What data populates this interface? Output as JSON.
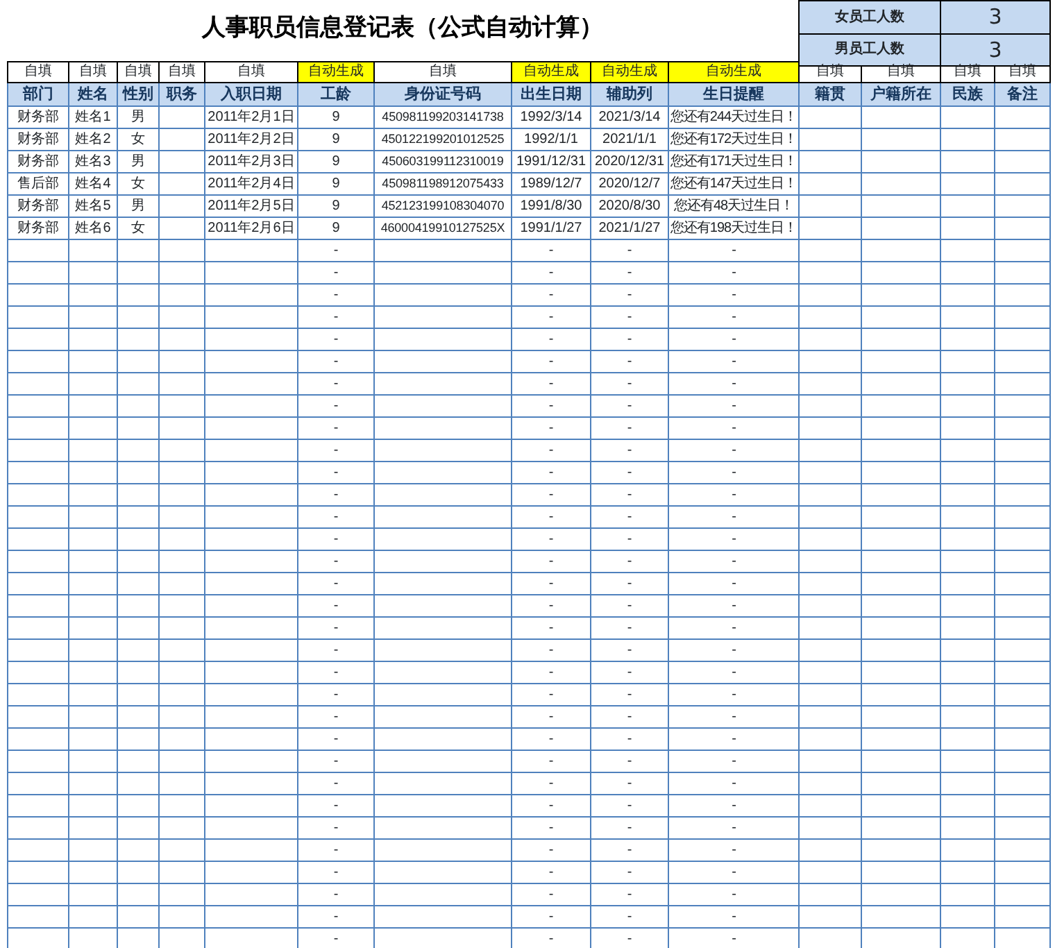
{
  "title": "人事职员信息登记表（公式自动计算）",
  "summary": [
    {
      "label": "女员工人数",
      "value": "3"
    },
    {
      "label": "男员工人数",
      "value": "3"
    }
  ],
  "columns": [
    {
      "fill": "自填",
      "kind": "manual",
      "header": "部门"
    },
    {
      "fill": "自填",
      "kind": "manual",
      "header": "姓名"
    },
    {
      "fill": "自填",
      "kind": "manual",
      "header": "性别"
    },
    {
      "fill": "自填",
      "kind": "manual",
      "header": "职务"
    },
    {
      "fill": "自填",
      "kind": "manual",
      "header": "入职日期"
    },
    {
      "fill": "自动生成",
      "kind": "auto",
      "header": "工龄"
    },
    {
      "fill": "自填",
      "kind": "manual",
      "header": "身份证号码"
    },
    {
      "fill": "自动生成",
      "kind": "auto",
      "header": "出生日期"
    },
    {
      "fill": "自动生成",
      "kind": "auto",
      "header": "辅助列"
    },
    {
      "fill": "自动生成",
      "kind": "auto",
      "header": "生日提醒"
    },
    {
      "fill": "自填",
      "kind": "manual",
      "header": "籍贯"
    },
    {
      "fill": "自填",
      "kind": "manual",
      "header": "户籍所在"
    },
    {
      "fill": "自填",
      "kind": "manual",
      "header": "民族"
    },
    {
      "fill": "自填",
      "kind": "manual",
      "header": "备注"
    }
  ],
  "rows": [
    [
      "财务部",
      "姓名1",
      "男",
      null,
      "2011年2月1日",
      "9",
      "450981199203141738",
      "1992/3/14",
      "2021/3/14",
      "您还有244天过生日！",
      null,
      null,
      null,
      null
    ],
    [
      "财务部",
      "姓名2",
      "女",
      null,
      "2011年2月2日",
      "9",
      "450122199201012525",
      "1992/1/1",
      "2021/1/1",
      "您还有172天过生日！",
      null,
      null,
      null,
      null
    ],
    [
      "财务部",
      "姓名3",
      "男",
      null,
      "2011年2月3日",
      "9",
      "450603199112310019",
      "1991/12/31",
      "2020/12/31",
      "您还有171天过生日！",
      null,
      null,
      null,
      null
    ],
    [
      "售后部",
      "姓名4",
      "女",
      null,
      "2011年2月4日",
      "9",
      "450981198912075433",
      "1989/12/7",
      "2020/12/7",
      "您还有147天过生日！",
      null,
      null,
      null,
      null
    ],
    [
      "财务部",
      "姓名5",
      "男",
      null,
      "2011年2月5日",
      "9",
      "452123199108304070",
      "1991/8/30",
      "2020/8/30",
      "您还有48天过生日！",
      null,
      null,
      null,
      null
    ],
    [
      "财务部",
      "姓名6",
      "女",
      null,
      "2011年2月6日",
      "9",
      "46000419910127525X",
      "1991/1/27",
      "2021/1/27",
      "您还有198天过生日！",
      null,
      null,
      null,
      null
    ],
    [
      null,
      null,
      null,
      null,
      null,
      "-",
      null,
      "-",
      "-",
      "-",
      null,
      null,
      null,
      null
    ],
    [
      null,
      null,
      null,
      null,
      null,
      "-",
      null,
      "-",
      "-",
      "-",
      null,
      null,
      null,
      null
    ],
    [
      null,
      null,
      null,
      null,
      null,
      "-",
      null,
      "-",
      "-",
      "-",
      null,
      null,
      null,
      null
    ],
    [
      null,
      null,
      null,
      null,
      null,
      "-",
      null,
      "-",
      "-",
      "-",
      null,
      null,
      null,
      null
    ],
    [
      null,
      null,
      null,
      null,
      null,
      "-",
      null,
      "-",
      "-",
      "-",
      null,
      null,
      null,
      null
    ],
    [
      null,
      null,
      null,
      null,
      null,
      "-",
      null,
      "-",
      "-",
      "-",
      null,
      null,
      null,
      null
    ],
    [
      null,
      null,
      null,
      null,
      null,
      "-",
      null,
      "-",
      "-",
      "-",
      null,
      null,
      null,
      null
    ],
    [
      null,
      null,
      null,
      null,
      null,
      "-",
      null,
      "-",
      "-",
      "-",
      null,
      null,
      null,
      null
    ],
    [
      null,
      null,
      null,
      null,
      null,
      "-",
      null,
      "-",
      "-",
      "-",
      null,
      null,
      null,
      null
    ],
    [
      null,
      null,
      null,
      null,
      null,
      "-",
      null,
      "-",
      "-",
      "-",
      null,
      null,
      null,
      null
    ],
    [
      null,
      null,
      null,
      null,
      null,
      "-",
      null,
      "-",
      "-",
      "-",
      null,
      null,
      null,
      null
    ],
    [
      null,
      null,
      null,
      null,
      null,
      "-",
      null,
      "-",
      "-",
      "-",
      null,
      null,
      null,
      null
    ],
    [
      null,
      null,
      null,
      null,
      null,
      "-",
      null,
      "-",
      "-",
      "-",
      null,
      null,
      null,
      null
    ],
    [
      null,
      null,
      null,
      null,
      null,
      "-",
      null,
      "-",
      "-",
      "-",
      null,
      null,
      null,
      null
    ],
    [
      null,
      null,
      null,
      null,
      null,
      "-",
      null,
      "-",
      "-",
      "-",
      null,
      null,
      null,
      null
    ],
    [
      null,
      null,
      null,
      null,
      null,
      "-",
      null,
      "-",
      "-",
      "-",
      null,
      null,
      null,
      null
    ],
    [
      null,
      null,
      null,
      null,
      null,
      "-",
      null,
      "-",
      "-",
      "-",
      null,
      null,
      null,
      null
    ],
    [
      null,
      null,
      null,
      null,
      null,
      "-",
      null,
      "-",
      "-",
      "-",
      null,
      null,
      null,
      null
    ],
    [
      null,
      null,
      null,
      null,
      null,
      "-",
      null,
      "-",
      "-",
      "-",
      null,
      null,
      null,
      null
    ],
    [
      null,
      null,
      null,
      null,
      null,
      "-",
      null,
      "-",
      "-",
      "-",
      null,
      null,
      null,
      null
    ],
    [
      null,
      null,
      null,
      null,
      null,
      "-",
      null,
      "-",
      "-",
      "-",
      null,
      null,
      null,
      null
    ],
    [
      null,
      null,
      null,
      null,
      null,
      "-",
      null,
      "-",
      "-",
      "-",
      null,
      null,
      null,
      null
    ],
    [
      null,
      null,
      null,
      null,
      null,
      "-",
      null,
      "-",
      "-",
      "-",
      null,
      null,
      null,
      null
    ],
    [
      null,
      null,
      null,
      null,
      null,
      "-",
      null,
      "-",
      "-",
      "-",
      null,
      null,
      null,
      null
    ],
    [
      null,
      null,
      null,
      null,
      null,
      "-",
      null,
      "-",
      "-",
      "-",
      null,
      null,
      null,
      null
    ],
    [
      null,
      null,
      null,
      null,
      null,
      "-",
      null,
      "-",
      "-",
      "-",
      null,
      null,
      null,
      null
    ],
    [
      null,
      null,
      null,
      null,
      null,
      "-",
      null,
      "-",
      "-",
      "-",
      null,
      null,
      null,
      null
    ],
    [
      null,
      null,
      null,
      null,
      null,
      "-",
      null,
      "-",
      "-",
      "-",
      null,
      null,
      null,
      null
    ],
    [
      null,
      null,
      null,
      null,
      null,
      "-",
      null,
      "-",
      "-",
      "-",
      null,
      null,
      null,
      null
    ],
    [
      null,
      null,
      null,
      null,
      null,
      "-",
      null,
      "-",
      "-",
      "-",
      null,
      null,
      null,
      null
    ],
    [
      null,
      null,
      null,
      null,
      null,
      "-",
      null,
      "-",
      "-",
      "-",
      null,
      null,
      null,
      null
    ],
    [
      null,
      null,
      null,
      null,
      null,
      "-",
      null,
      "-",
      "-",
      "-",
      null,
      null,
      null,
      null
    ]
  ]
}
